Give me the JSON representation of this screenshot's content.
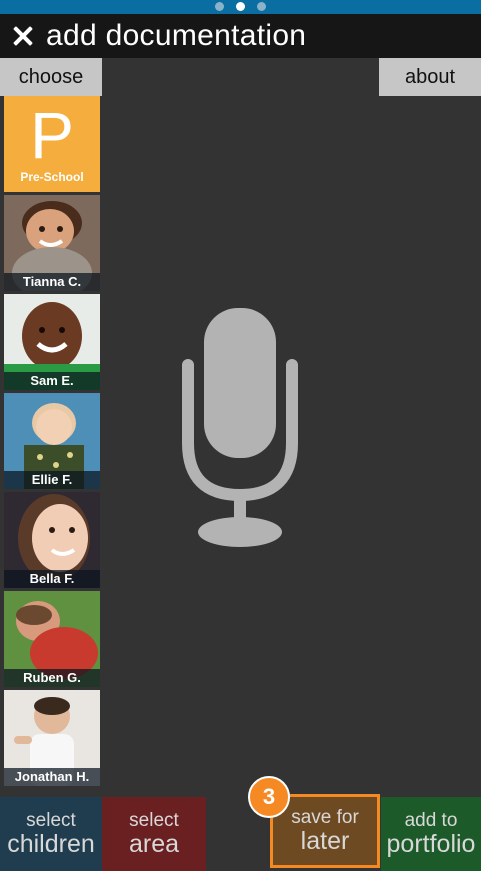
{
  "header": {
    "title": "add documentation"
  },
  "pager": {
    "count": 3,
    "active": 1
  },
  "toolbar": {
    "choose_label": "choose",
    "about_label": "about"
  },
  "classroom": {
    "letter": "P",
    "label": "Pre-School",
    "color": "#f5ad3d"
  },
  "children": [
    {
      "name": "Tianna C."
    },
    {
      "name": "Sam E."
    },
    {
      "name": "Ellie F."
    },
    {
      "name": "Bella F."
    },
    {
      "name": "Ruben G."
    },
    {
      "name": "Jonathan H."
    }
  ],
  "bottom": {
    "select_children": {
      "line1": "select",
      "line2": "children"
    },
    "select_area": {
      "line1": "select",
      "line2": "area"
    },
    "save_for_later": {
      "line1": "save for",
      "line2": "later"
    },
    "add_to_portfolio": {
      "line1": "add to",
      "line2": "portfolio"
    }
  },
  "annotation": {
    "step": "3"
  },
  "colors": {
    "accent": "#f58a25",
    "top_strip": "#0a6ea3",
    "select_children": "#1f3d4e",
    "select_area": "#6a1f21",
    "save_for_later": "#6e4a22",
    "add_to_portfolio": "#1d5a2a"
  },
  "icons": {
    "close": "close-icon",
    "microphone": "microphone-icon"
  }
}
